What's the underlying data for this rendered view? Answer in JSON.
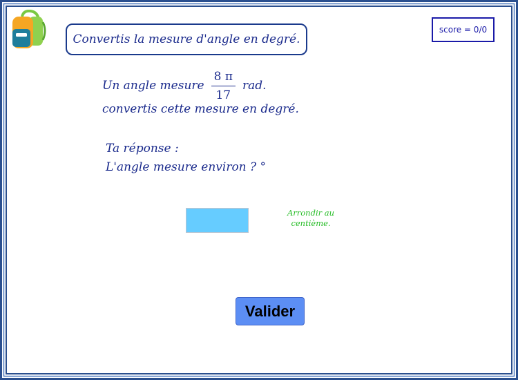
{
  "header": {
    "title": "Convertis la mesure d'angle en degré.",
    "score": "score = 0/0"
  },
  "question": {
    "prefix": "Un angle mesure",
    "fraction_numerator": "8 π",
    "fraction_denominator": "17",
    "unit": "rad.",
    "instruction": "convertis cette mesure en degré."
  },
  "answer": {
    "label": "Ta réponse :",
    "sentence": "L'angle mesure environ ? °",
    "input_value": "",
    "hint_line1": "Arrondir au",
    "hint_line2": "centième."
  },
  "buttons": {
    "validate_label": "Valider"
  },
  "colors": {
    "frame": "#2a4f8f",
    "text": "#1a2a8c",
    "input_fill": "#66ccff",
    "hint": "#22bb22",
    "button": "#5c8ef4"
  },
  "icons": {
    "logo": "backpack-icon"
  }
}
